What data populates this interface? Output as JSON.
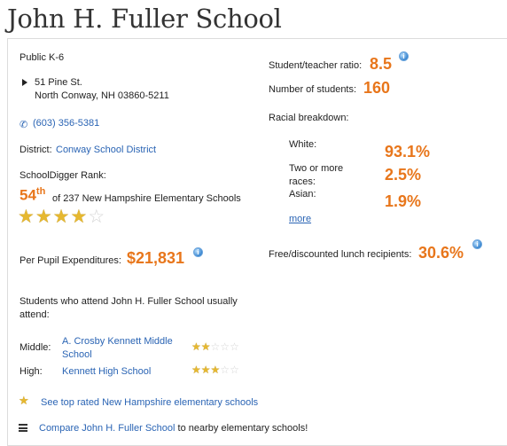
{
  "page_title": "John H. Fuller School",
  "left": {
    "grades": "Public K-6",
    "address_line1": "51 Pine St.",
    "address_line2": "North Conway, NH  03860-5211",
    "phone": "(603) 356-5381",
    "district_label": "District:",
    "district_link": "Conway School District",
    "rank_label": "SchoolDigger Rank:",
    "rank_number": "54",
    "rank_suffix": "th",
    "rank_desc": "of 237 New Hampshire Elementary Schools",
    "rating_stars": 4,
    "ppe_label": "Per Pupil Expenditures:",
    "ppe_value": "$21,831",
    "attend_line1": "Students who attend John H. Fuller School usually",
    "attend_line2": "attend:",
    "middle_label": "Middle:",
    "middle_link_line1": "A. Crosby Kennett Middle",
    "middle_link_line2": "School",
    "middle_stars": 2,
    "high_label": "High:",
    "high_link": "Kennett High School",
    "high_stars": 3,
    "top_rated_link": "See top rated New Hampshire elementary schools",
    "compare_link": "Compare John H. Fuller School",
    "compare_suffix": " to nearby elementary schools!"
  },
  "right": {
    "ratio_label": "Student/teacher ratio:",
    "ratio_value": "8.5",
    "students_label": "Number of students:",
    "students_value": "160",
    "racial_label": "Racial breakdown:",
    "race_white_label": "White:",
    "race_white_value": "93.1%",
    "race_two_label_line1": "Two or more",
    "race_two_label_line2": "races:",
    "race_two_value": "2.5%",
    "race_asian_label": "Asian:",
    "race_asian_value": "1.9%",
    "more_link": "more",
    "lunch_label": "Free/discounted lunch recipients:",
    "lunch_value": "30.6%"
  },
  "colors": {
    "accent": "#e8761b",
    "link": "#2a64b4",
    "star": "#e6b830"
  }
}
